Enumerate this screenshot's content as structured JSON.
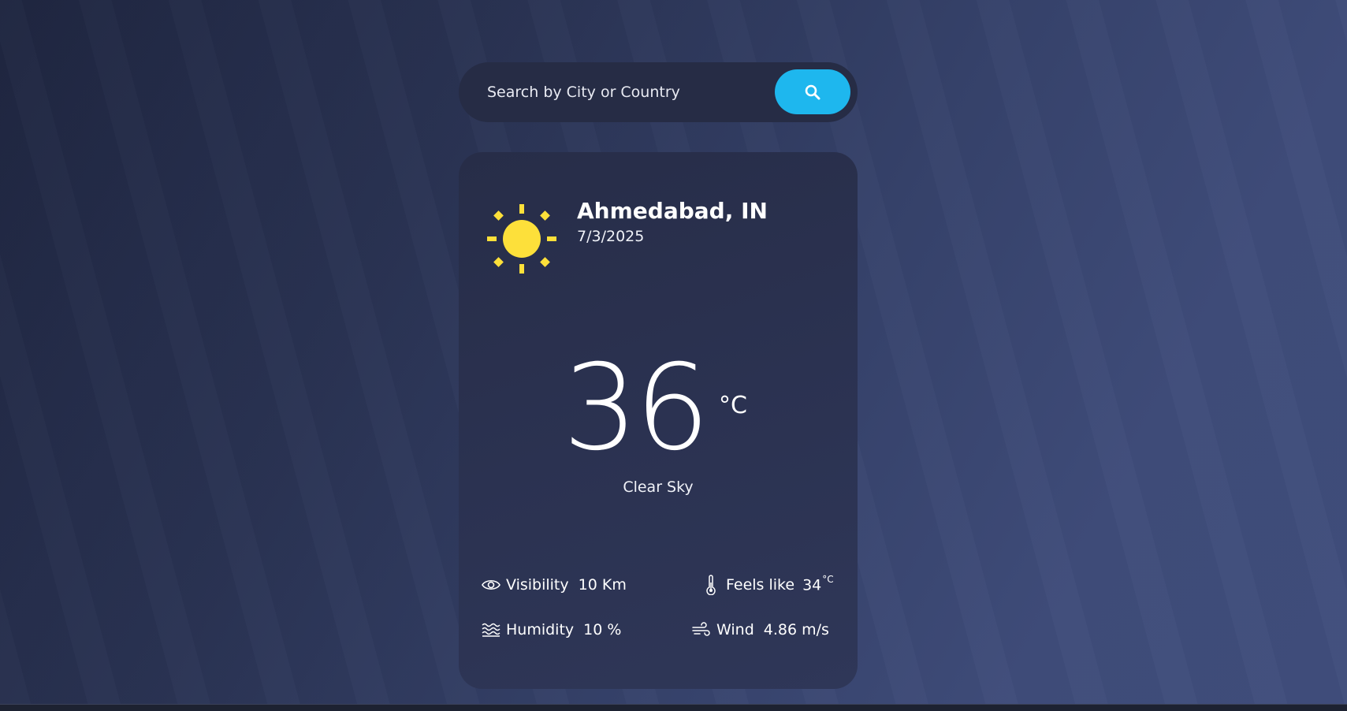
{
  "search": {
    "placeholder": "Search by City or Country",
    "button_icon": "search-icon",
    "button_color": "#1eb7ee"
  },
  "weather": {
    "icon": "sun-icon",
    "icon_color": "#fde03a",
    "location": "Ahmedabad, IN",
    "date": "7/3/2025",
    "temperature": "36",
    "temperature_unit": "°C",
    "condition": "Clear Sky"
  },
  "stats": {
    "visibility": {
      "icon": "eye-icon",
      "label": "Visibility",
      "value": "10 Km"
    },
    "feels_like": {
      "icon": "thermometer-icon",
      "label": "Feels like",
      "value": "34",
      "unit": "°C"
    },
    "humidity": {
      "icon": "waves-icon",
      "label": "Humidity",
      "value": "10 %"
    },
    "wind": {
      "icon": "wind-icon",
      "label": "Wind",
      "value": "4.86 m/s"
    }
  }
}
